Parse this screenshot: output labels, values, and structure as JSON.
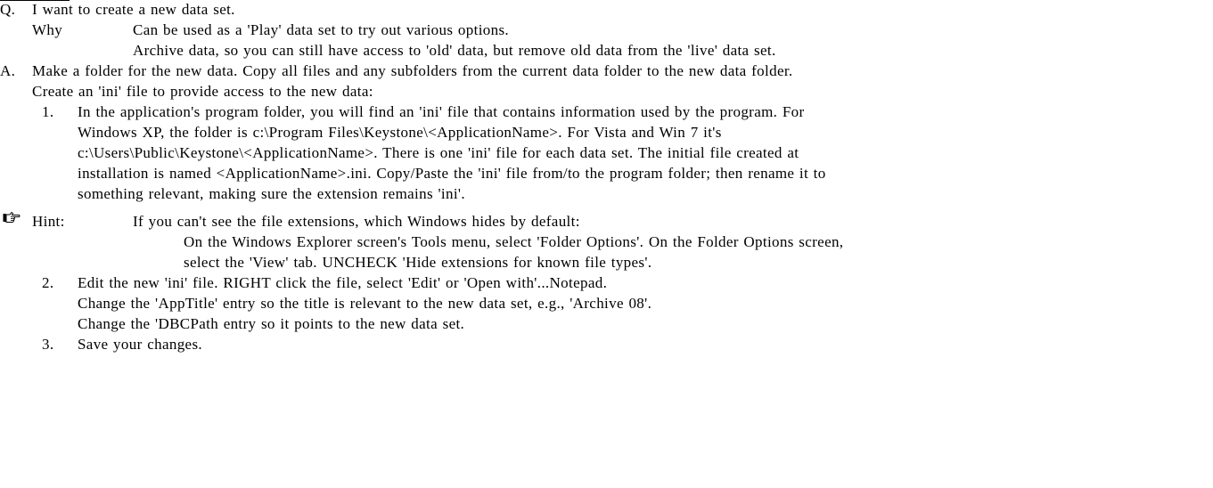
{
  "question": {
    "marker": "Q.",
    "text": "I want to create a new data set.",
    "why_label": "Why",
    "why_lines": [
      "Can be used as a 'Play' data set to try out various options.",
      "Archive data, so you can still have access to 'old' data, but remove old data from the 'live' data set."
    ]
  },
  "answer": {
    "marker": "A.",
    "lines": [
      "Make a folder for the new data. Copy all files and any subfolders from the current data folder to the new data folder.",
      "Create an 'ini' file to provide access to the new data:"
    ]
  },
  "steps": [
    {
      "number": "1.",
      "lines": [
        "In the application's program folder, you will find an 'ini' file that contains information used by the program. For",
        "Windows XP, the folder is c:\\Program Files\\Keystone\\<ApplicationName>. For Vista and Win 7 it's",
        "c:\\Users\\Public\\Keystone\\<ApplicationName>. There is one 'ini' file for each data set. The initial file created at",
        "installation is named <ApplicationName>.ini. Copy/Paste the 'ini' file from/to the program folder; then rename it to",
        "something relevant, making sure the extension remains 'ini'."
      ]
    },
    {
      "number": "2.",
      "lines": [
        "Edit the new 'ini' file. RIGHT click the file, select 'Edit' or 'Open with'...Notepad.",
        "Change the 'AppTitle' entry so the title is relevant to the new data set, e.g., 'Archive 08'.",
        "Change the 'DBCPath entry so it points to the new data set."
      ]
    },
    {
      "number": "3.",
      "lines": [
        "Save your changes."
      ]
    }
  ],
  "hint": {
    "icon": "pointing-hand-icon",
    "label": "Hint:",
    "intro": "If you can't see the file extensions, which Windows hides by default:",
    "lines": [
      "On the Windows Explorer screen's Tools menu, select 'Folder Options'. On the Folder Options screen,",
      "select the 'View' tab. UNCHECK 'Hide extensions for known file types'."
    ]
  }
}
